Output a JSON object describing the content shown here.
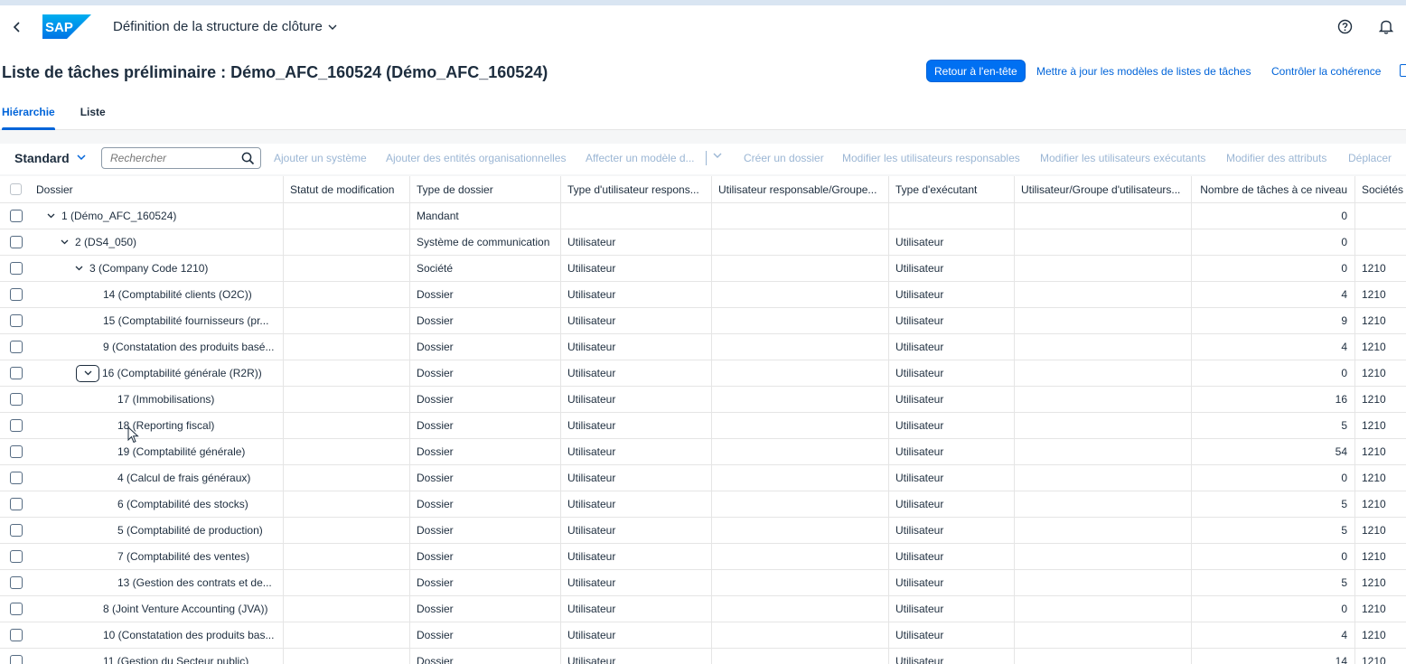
{
  "shell": {
    "app_title": "Définition de la structure de clôture",
    "logo_text": "SAP",
    "colors": {
      "brand": "#0070f2",
      "text": "#1d2d3e",
      "link": "#0064d9",
      "disabled": "#9bb6d4"
    }
  },
  "page": {
    "title": "Liste de tâches préliminaire : Démo_AFC_160524 (Démo_AFC_160524)",
    "actions": {
      "back_to_header": "Retour à l'en-tête",
      "update_templates": "Mettre à jour les modèles de listes de tâches",
      "check_consistency": "Contrôler la cohérence"
    },
    "tabs": [
      "Hiérarchie",
      "Liste"
    ],
    "active_tab": "Hiérarchie"
  },
  "toolbar": {
    "variant": "Standard",
    "search_placeholder": "Rechercher",
    "buttons": {
      "add_system": "Ajouter un système",
      "add_org_units": "Ajouter des entités organisationnelles",
      "assign_template": "Affecter un modèle d...",
      "create_folder": "Créer un dossier",
      "modify_responsible": "Modifier les utilisateurs responsables",
      "modify_executing": "Modifier les utilisateurs exécutants",
      "modify_attributes": "Modifier des attributs",
      "move": "Déplacer"
    }
  },
  "table": {
    "columns": {
      "dossier": "Dossier",
      "statut": "Statut de modification",
      "type_dossier": "Type de dossier",
      "type_resp": "Type d'utilisateur respons...",
      "user_resp": "Utilisateur responsable/Groupe...",
      "type_exec": "Type d'exécutant",
      "user_exec": "Utilisateur/Groupe d'utilisateurs...",
      "nb_taches": "Nombre de tâches à ce niveau",
      "societes": "Sociétés"
    },
    "rows": [
      {
        "label": "1 (Démo_AFC_160524)",
        "statut": "",
        "type": "Mandant",
        "type_resp": "",
        "user_resp": "",
        "type_exec": "",
        "user_exec": "",
        "nb": "0",
        "soc": ""
      },
      {
        "label": "2 (DS4_050)",
        "statut": "",
        "type": "Système de communication",
        "type_resp": "Utilisateur",
        "user_resp": "",
        "type_exec": "Utilisateur",
        "user_exec": "",
        "nb": "0",
        "soc": ""
      },
      {
        "label": "3 (Company Code 1210)",
        "statut": "",
        "type": "Société",
        "type_resp": "Utilisateur",
        "user_resp": "",
        "type_exec": "Utilisateur",
        "user_exec": "",
        "nb": "0",
        "soc": "1210"
      },
      {
        "label": "14 (Comptabilité clients (O2C))",
        "statut": "",
        "type": "Dossier",
        "type_resp": "Utilisateur",
        "user_resp": "",
        "type_exec": "Utilisateur",
        "user_exec": "",
        "nb": "4",
        "soc": "1210"
      },
      {
        "label": "15 (Comptabilité fournisseurs (pr...",
        "statut": "",
        "type": "Dossier",
        "type_resp": "Utilisateur",
        "user_resp": "",
        "type_exec": "Utilisateur",
        "user_exec": "",
        "nb": "9",
        "soc": "1210"
      },
      {
        "label": "9 (Constatation des produits basé...",
        "statut": "",
        "type": "Dossier",
        "type_resp": "Utilisateur",
        "user_resp": "",
        "type_exec": "Utilisateur",
        "user_exec": "",
        "nb": "4",
        "soc": "1210"
      },
      {
        "label": "16 (Comptabilité générale (R2R))",
        "statut": "",
        "type": "Dossier",
        "type_resp": "Utilisateur",
        "user_resp": "",
        "type_exec": "Utilisateur",
        "user_exec": "",
        "nb": "0",
        "soc": "1210"
      },
      {
        "label": "17 (Immobilisations)",
        "statut": "",
        "type": "Dossier",
        "type_resp": "Utilisateur",
        "user_resp": "",
        "type_exec": "Utilisateur",
        "user_exec": "",
        "nb": "16",
        "soc": "1210"
      },
      {
        "label": "18 (Reporting fiscal)",
        "statut": "",
        "type": "Dossier",
        "type_resp": "Utilisateur",
        "user_resp": "",
        "type_exec": "Utilisateur",
        "user_exec": "",
        "nb": "5",
        "soc": "1210"
      },
      {
        "label": "19 (Comptabilité générale)",
        "statut": "",
        "type": "Dossier",
        "type_resp": "Utilisateur",
        "user_resp": "",
        "type_exec": "Utilisateur",
        "user_exec": "",
        "nb": "54",
        "soc": "1210"
      },
      {
        "label": "4 (Calcul de frais généraux)",
        "statut": "",
        "type": "Dossier",
        "type_resp": "Utilisateur",
        "user_resp": "",
        "type_exec": "Utilisateur",
        "user_exec": "",
        "nb": "0",
        "soc": "1210"
      },
      {
        "label": "6 (Comptabilité des stocks)",
        "statut": "",
        "type": "Dossier",
        "type_resp": "Utilisateur",
        "user_resp": "",
        "type_exec": "Utilisateur",
        "user_exec": "",
        "nb": "5",
        "soc": "1210"
      },
      {
        "label": "5 (Comptabilité de production)",
        "statut": "",
        "type": "Dossier",
        "type_resp": "Utilisateur",
        "user_resp": "",
        "type_exec": "Utilisateur",
        "user_exec": "",
        "nb": "5",
        "soc": "1210"
      },
      {
        "label": "7 (Comptabilité des ventes)",
        "statut": "",
        "type": "Dossier",
        "type_resp": "Utilisateur",
        "user_resp": "",
        "type_exec": "Utilisateur",
        "user_exec": "",
        "nb": "0",
        "soc": "1210"
      },
      {
        "label": "13 (Gestion des contrats et de...",
        "statut": "",
        "type": "Dossier",
        "type_resp": "Utilisateur",
        "user_resp": "",
        "type_exec": "Utilisateur",
        "user_exec": "",
        "nb": "5",
        "soc": "1210"
      },
      {
        "label": "8 (Joint Venture Accounting (JVA))",
        "statut": "",
        "type": "Dossier",
        "type_resp": "Utilisateur",
        "user_resp": "",
        "type_exec": "Utilisateur",
        "user_exec": "",
        "nb": "0",
        "soc": "1210"
      },
      {
        "label": "10 (Constatation des produits bas...",
        "statut": "",
        "type": "Dossier",
        "type_resp": "Utilisateur",
        "user_resp": "",
        "type_exec": "Utilisateur",
        "user_exec": "",
        "nb": "4",
        "soc": "1210"
      },
      {
        "label": "11 (Gestion du Secteur public)",
        "statut": "",
        "type": "Dossier",
        "type_resp": "Utilisateur",
        "user_resp": "",
        "type_exec": "Utilisateur",
        "user_exec": "",
        "nb": "14",
        "soc": "1210"
      }
    ]
  }
}
